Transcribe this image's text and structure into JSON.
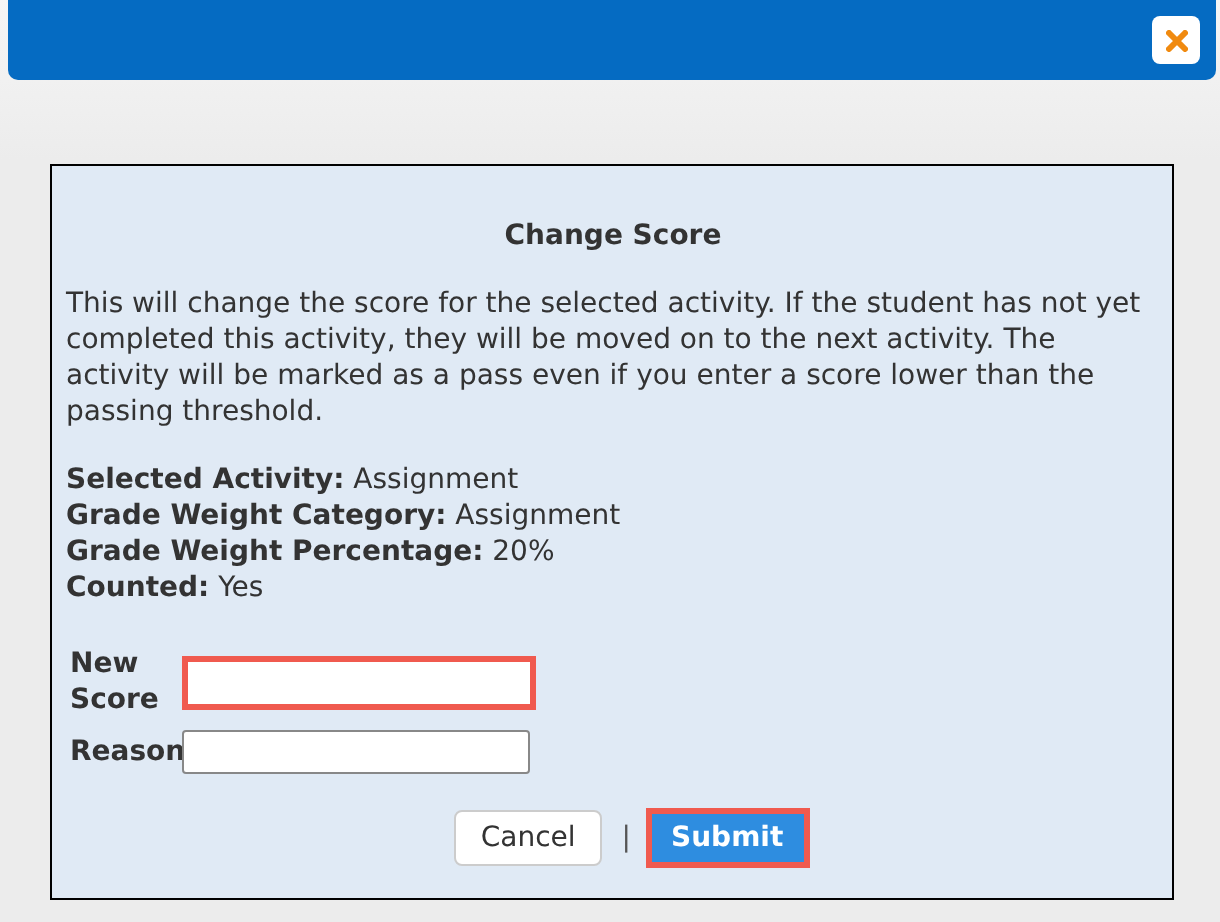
{
  "dialog": {
    "title": "Change Score",
    "description": "This will change the score for the selected activity. If the student has not yet completed this activity, they will be moved on to the next activity. The activity will be marked as a pass even if you enter a score lower than the passing threshold.",
    "details": [
      {
        "label": "Selected Activity:",
        "value": "Assignment"
      },
      {
        "label": "Grade Weight Category:",
        "value": "Assignment"
      },
      {
        "label": "Grade Weight Percentage:",
        "value": "20%"
      },
      {
        "label": "Counted:",
        "value": "Yes"
      }
    ],
    "fields": [
      {
        "label": "New Score",
        "highlighted": true
      },
      {
        "label": "Reason",
        "highlighted": false
      }
    ],
    "buttons": [
      {
        "label": "Cancel",
        "kind": "secondary",
        "highlighted": false
      },
      {
        "label": "Submit",
        "kind": "primary",
        "highlighted": true
      }
    ],
    "separator": "|"
  }
}
